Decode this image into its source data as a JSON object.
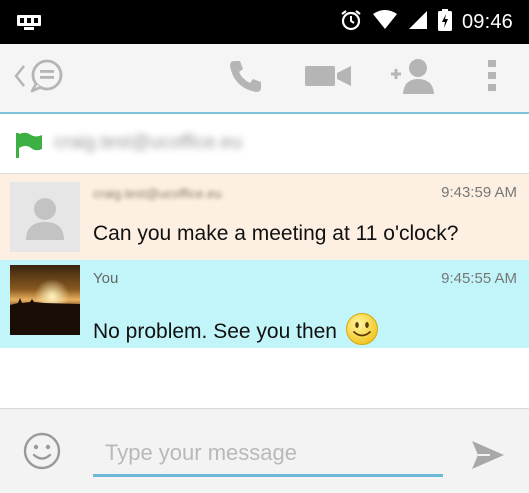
{
  "status_bar": {
    "time": "09:46",
    "icons": [
      "notification-icon",
      "alarm-icon",
      "wifi-icon",
      "signal-icon",
      "battery-icon"
    ]
  },
  "action_bar": {
    "icons": [
      "back-chevron-icon",
      "chat-bubble-icon",
      "phone-icon",
      "video-camera-icon",
      "add-person-icon",
      "overflow-menu-icon"
    ],
    "icon_color": "#b5b5b5"
  },
  "contact": {
    "name": "craig.test@ucoffice.eu",
    "flag_color": "#3cb043"
  },
  "messages": [
    {
      "sender": "craig.test@ucoffice.eu",
      "time": "9:43:59 AM",
      "text": "Can you make a meeting at 11 o'clock?",
      "background": "#fdf0e2"
    },
    {
      "sender": "You",
      "time": "9:45:55 AM",
      "text": "No problem. See you then",
      "emoji": "smiley-emoji",
      "background": "#c2f5f9"
    }
  ],
  "composer": {
    "placeholder": "Type your message",
    "value": "",
    "accent": "#6cb8d6"
  }
}
